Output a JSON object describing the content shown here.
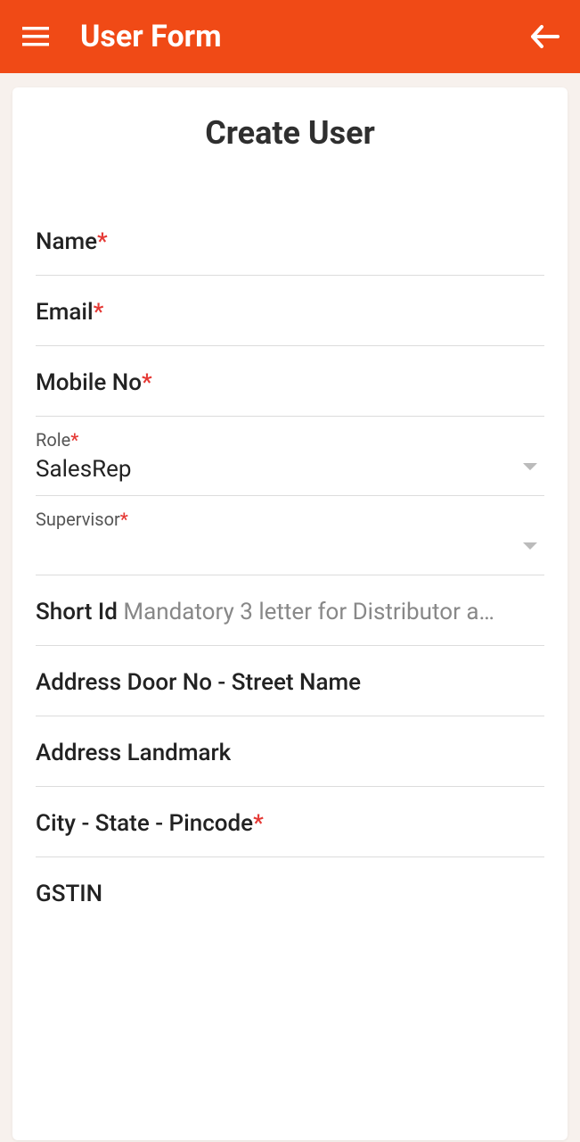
{
  "header": {
    "title": "User Form"
  },
  "card": {
    "title": "Create User"
  },
  "fields": {
    "name": {
      "label": "Name",
      "required": "*"
    },
    "email": {
      "label": "Email",
      "required": "*"
    },
    "mobile": {
      "label": "Mobile No",
      "required": "*"
    },
    "role": {
      "label": "Role",
      "required": "*",
      "value": "SalesRep"
    },
    "supervisor": {
      "label": "Supervisor",
      "required": "*",
      "value": ""
    },
    "shortid": {
      "label": "Short Id ",
      "hint": "Mandatory 3 letter for Distributor a…"
    },
    "address1": {
      "label": "Address Door No - Street Name"
    },
    "address2": {
      "label": "Address Landmark"
    },
    "city": {
      "label": "City - State - Pincode",
      "required": "*"
    },
    "gstin": {
      "label": "GSTIN"
    }
  }
}
